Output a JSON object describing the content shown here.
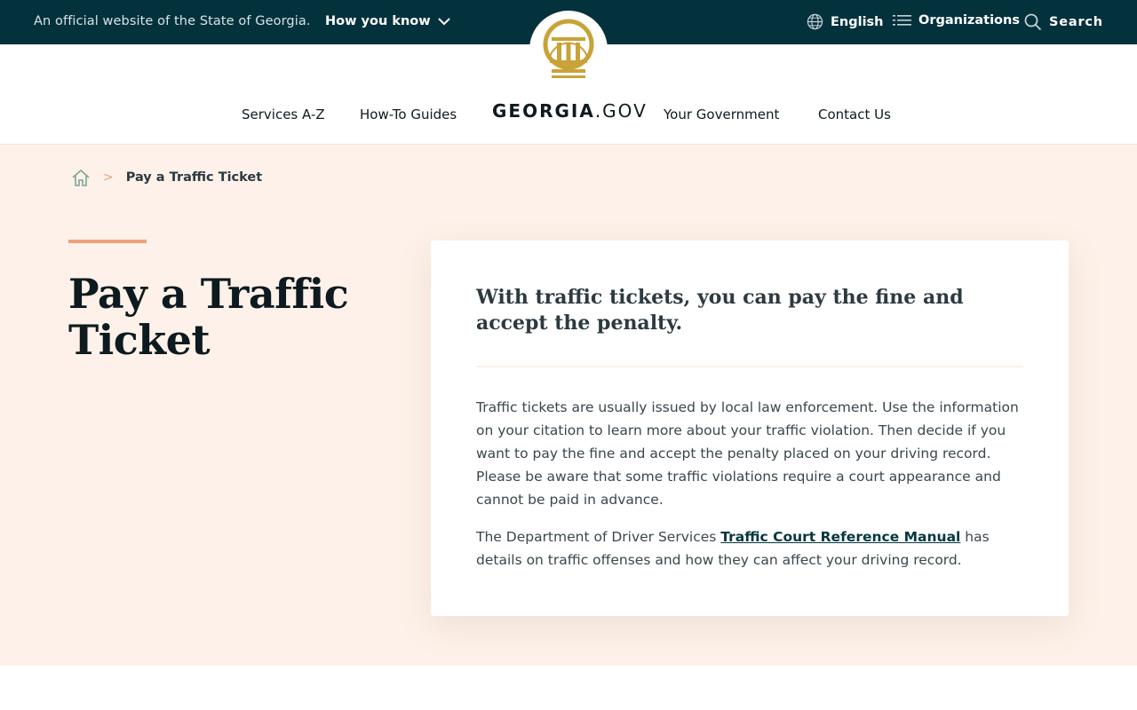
{
  "topbar": {
    "official_text": "An official website of the State of Georgia.",
    "how_you_know": "How you know",
    "language": "English",
    "organizations": "Organizations",
    "search": "Search"
  },
  "nav": {
    "services": "Services A-Z",
    "howto": "How-To Guides",
    "brand_bold": "GEORGIA",
    "brand_rest": ".GOV",
    "government": "Your Government",
    "contact": "Contact Us"
  },
  "breadcrumb": {
    "separator": ">",
    "current": "Pay a Traffic Ticket"
  },
  "page": {
    "title": "Pay a Traffic Ticket"
  },
  "card": {
    "lead": "With traffic tickets, you can pay the fine and accept the penalty.",
    "paragraph1": "Traffic tickets are usually issued by local law enforcement. Use the information on your citation to learn more about your traffic violation. Then decide if you want to pay the fine and accept the penalty placed on your driving record. Please be aware that some traffic violations require a court appearance and cannot be paid in advance.",
    "p2_before": "The Department of Driver Services ",
    "p2_link": "Traffic Court Reference Manual",
    "p2_after": " has details on traffic offenses and how they can affect your driving record."
  },
  "colors": {
    "topbar": "#04323c",
    "hero_bg": "#fdf1e9",
    "accent": "#f0a07c",
    "seal_gold": "#c9a238"
  },
  "icons": [
    "chevron-down-icon",
    "globe-icon",
    "list-icon",
    "search-icon",
    "home-icon",
    "state-seal-icon"
  ]
}
